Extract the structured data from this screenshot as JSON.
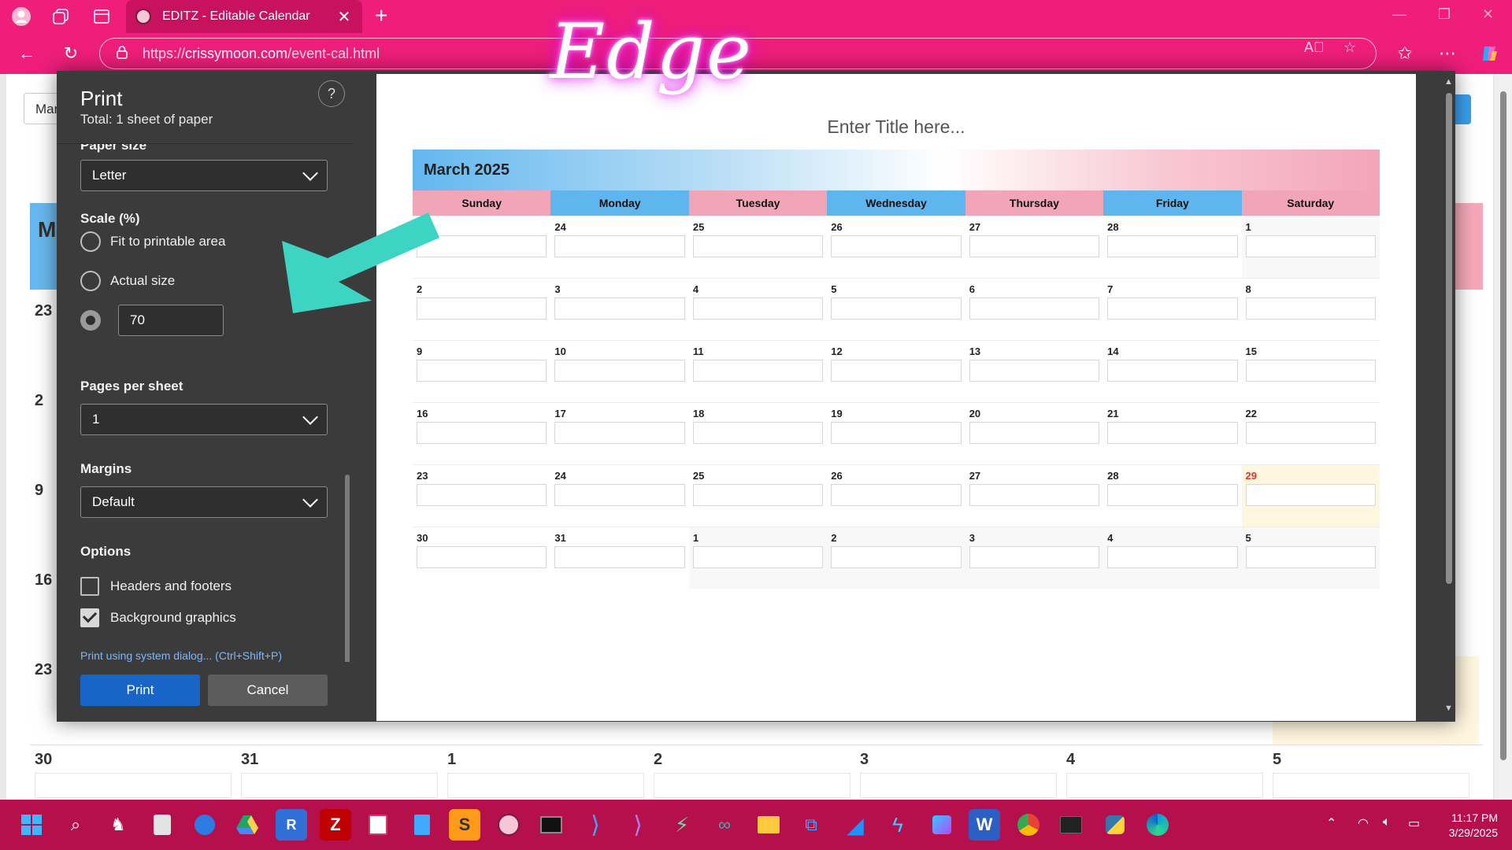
{
  "browser": {
    "tab_title": "EDITZ - Editable Calendar",
    "url_prefix": "https://",
    "url_domain": "crissymoon.com",
    "url_path": "/event-cal.html",
    "overlay_text": "Edge"
  },
  "print_dialog": {
    "title": "Print",
    "subtitle": "Total: 1 sheet of paper",
    "paper_size_label": "Paper size",
    "paper_size_value": "Letter",
    "scale_label": "Scale (%)",
    "scale_options": [
      "Fit to printable area",
      "Actual size"
    ],
    "scale_value": "70",
    "pages_per_sheet_label": "Pages per sheet",
    "pages_per_sheet_value": "1",
    "margins_label": "Margins",
    "margins_value": "Default",
    "options_label": "Options",
    "option_headers_footers": "Headers and footers",
    "option_background_graphics": "Background graphics",
    "system_dialog_link": "Print using system dialog... (Ctrl+Shift+P)",
    "print_button": "Print",
    "cancel_button": "Cancel"
  },
  "preview": {
    "title": "Enter Title here...",
    "month": "March 2025",
    "weekdays": [
      "Sunday",
      "Monday",
      "Tuesday",
      "Wednesday",
      "Thursday",
      "Friday",
      "Saturday"
    ],
    "weeks": [
      [
        "23",
        "24",
        "25",
        "26",
        "27",
        "28",
        "1"
      ],
      [
        "2",
        "3",
        "4",
        "5",
        "6",
        "7",
        "8"
      ],
      [
        "9",
        "10",
        "11",
        "12",
        "13",
        "14",
        "15"
      ],
      [
        "16",
        "17",
        "18",
        "19",
        "20",
        "21",
        "22"
      ],
      [
        "23",
        "24",
        "25",
        "26",
        "27",
        "28",
        "29"
      ],
      [
        "30",
        "31",
        "1",
        "2",
        "3",
        "4",
        "5"
      ]
    ]
  },
  "background_page": {
    "month_input": "Mar",
    "month_heading": "M",
    "row_numbers": [
      "23",
      "2",
      "9",
      "16",
      "23"
    ],
    "bottom_row": [
      "30",
      "31",
      "1",
      "2",
      "3",
      "4",
      "5"
    ]
  },
  "taskbar": {
    "time": "11:17 PM",
    "date": "3/29/2025"
  },
  "colors": {
    "browser_chrome": "#ee1e7a",
    "taskbar": "#b5104b",
    "print_button": "#1766c7",
    "annotation_arrow": "#3ed4c4",
    "calendar_blue": "#5fb6ef",
    "calendar_pink": "#f3a5b8"
  },
  "icons": [
    "profile-icon",
    "workspaces-icon",
    "tab-actions-icon",
    "back-icon",
    "refresh-icon",
    "lock-icon",
    "read-aloud-icon",
    "favorite-star-icon",
    "favorites-icon",
    "more-icon",
    "copilot-icon",
    "help-icon",
    "chevron-down-icon",
    "windows-start-icon",
    "search-icon"
  ]
}
